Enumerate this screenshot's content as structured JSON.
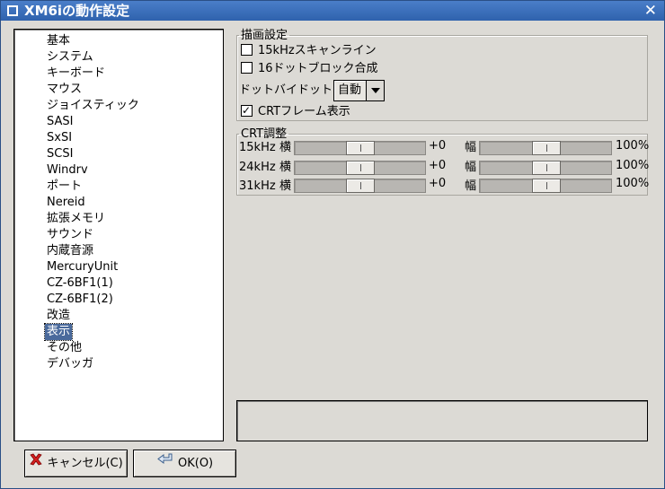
{
  "window": {
    "title": "XM6iの動作設定",
    "close_glyph": "✕"
  },
  "tree": {
    "items": [
      {
        "label": "基本",
        "selected": false
      },
      {
        "label": "システム",
        "selected": false
      },
      {
        "label": "キーボード",
        "selected": false
      },
      {
        "label": "マウス",
        "selected": false
      },
      {
        "label": "ジョイスティック",
        "selected": false
      },
      {
        "label": "SASI",
        "selected": false
      },
      {
        "label": "SxSI",
        "selected": false
      },
      {
        "label": "SCSI",
        "selected": false
      },
      {
        "label": "Windrv",
        "selected": false
      },
      {
        "label": "ポート",
        "selected": false
      },
      {
        "label": "Nereid",
        "selected": false
      },
      {
        "label": "拡張メモリ",
        "selected": false
      },
      {
        "label": "サウンド",
        "selected": false
      },
      {
        "label": "内蔵音源",
        "selected": false
      },
      {
        "label": "MercuryUnit",
        "selected": false
      },
      {
        "label": "CZ-6BF1(1)",
        "selected": false
      },
      {
        "label": "CZ-6BF1(2)",
        "selected": false
      },
      {
        "label": "改造",
        "selected": false
      },
      {
        "label": "表示",
        "selected": true
      },
      {
        "label": "その他",
        "selected": false
      },
      {
        "label": "デバッガ",
        "selected": false
      }
    ]
  },
  "drawing": {
    "legend": "描画設定",
    "scanline_15khz": {
      "label": "15kHzスキャンライン",
      "checked": false
    },
    "block_16dot": {
      "label": "16ドットブロック合成",
      "checked": false
    },
    "dot_by_dot": {
      "label": "ドットバイドット",
      "value": "自動"
    },
    "crt_frame": {
      "label": "CRTフレーム表示",
      "checked": true
    }
  },
  "crt": {
    "legend": "CRT調整",
    "rows": [
      {
        "freq": "15kHz",
        "h_label": "横",
        "h_value_text": "+0",
        "h_pos": 0.5,
        "w_label": "幅",
        "w_value_text": "100%",
        "w_pos": 0.5
      },
      {
        "freq": "24kHz",
        "h_label": "横",
        "h_value_text": "+0",
        "h_pos": 0.5,
        "w_label": "幅",
        "w_value_text": "100%",
        "w_pos": 0.5
      },
      {
        "freq": "31kHz",
        "h_label": "横",
        "h_value_text": "+0",
        "h_pos": 0.5,
        "w_label": "幅",
        "w_value_text": "100%",
        "w_pos": 0.5
      }
    ]
  },
  "buttons": {
    "cancel": "キャンセル(C)",
    "ok": "OK(O)"
  },
  "colors": {
    "titlebar": "#2f62ad",
    "selection": "#4a6a9c",
    "cancel_icon": "#d62020"
  },
  "icons": {
    "cancel": "red-x-icon",
    "ok": "enter-arrow-icon"
  }
}
